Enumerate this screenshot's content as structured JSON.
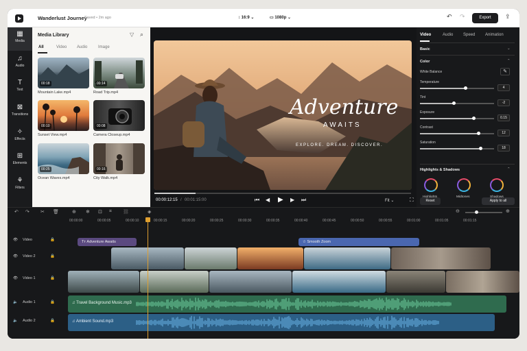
{
  "project": {
    "title": "Wanderlust Journey",
    "saved": "Saved • 2m ago",
    "ratio": "16:9",
    "resolution": "1080p",
    "export_label": "Export"
  },
  "rail": [
    {
      "label": "Media",
      "icon": "media-icon",
      "glyph": "▦"
    },
    {
      "label": "Audio",
      "icon": "music-note-icon",
      "glyph": "♫"
    },
    {
      "label": "Text",
      "icon": "text-icon",
      "glyph": "T"
    },
    {
      "label": "Transitions",
      "icon": "transitions-icon",
      "glyph": "⊠"
    },
    {
      "label": "Effects",
      "icon": "effects-icon",
      "glyph": "✧"
    },
    {
      "label": "Elements",
      "icon": "elements-icon",
      "glyph": "⊞"
    },
    {
      "label": "Filters",
      "icon": "filters-icon",
      "glyph": "⚘"
    }
  ],
  "library": {
    "title": "Media Library",
    "tabs": [
      "All",
      "Video",
      "Audio",
      "Image"
    ],
    "items": [
      {
        "name": "Mountain Lake.mp4",
        "dur": "00:18"
      },
      {
        "name": "Road Trip.mp4",
        "dur": "00:14"
      },
      {
        "name": "Sunset View.mp4",
        "dur": "00:10"
      },
      {
        "name": "Camera Closeup.mp4",
        "dur": "00:08"
      },
      {
        "name": "Ocean Waves.mp4",
        "dur": "00:25"
      },
      {
        "name": "City Walk.mp4",
        "dur": "00:16"
      }
    ]
  },
  "preview": {
    "headline": "Adventure",
    "sub": "AWAITS",
    "tagline": "EXPLORE. DREAM. DISCOVER.",
    "current": "00:00:12:15",
    "total": "00:01:15:00",
    "fit": "Fit"
  },
  "props": {
    "tabs": [
      "Video",
      "Audio",
      "Speed",
      "Animation"
    ],
    "basic": "Basic",
    "color": "Color",
    "white_balance": "White Balance",
    "sliders": [
      {
        "label": "Temperature",
        "value": "4",
        "pos": 0.62
      },
      {
        "label": "Tint",
        "value": "-2",
        "pos": 0.46
      },
      {
        "label": "Exposure",
        "value": "0.15",
        "pos": 0.73
      },
      {
        "label": "Contrast",
        "value": "12",
        "pos": 0.79
      },
      {
        "label": "Saturation",
        "value": "18",
        "pos": 0.82
      }
    ],
    "hs": "Highlights & Shadows",
    "wheels": [
      "Highlights",
      "Midtones",
      "Shadows"
    ],
    "reset": "Reset",
    "apply": "Apply to all"
  },
  "timeline": {
    "ticks": [
      "00:00:00",
      "00:00:05",
      "00:00:10",
      "00:00:15",
      "00:00:20",
      "00:00:25",
      "00:00:30",
      "00:00:35",
      "00:00:40",
      "00:00:45",
      "00:00:50",
      "00:00:55",
      "00:01:00",
      "00:01:05",
      "00:01:15"
    ],
    "tracks": [
      "Video",
      "Video 2",
      "Video 1",
      "Audio 1",
      "Audio 2"
    ],
    "clips": {
      "text1": "Adventure Awaits",
      "text2": "Smooth Zoom",
      "audio1": "Travel Background Music.mp3",
      "audio2": "Ambient Sound.mp3"
    }
  },
  "colors": {
    "accent": "#e0a030",
    "text_clip": "#5b4a80",
    "zoom_clip": "#4a67b0",
    "audio1": "#2f6b4e",
    "audio2": "#2c5f86"
  }
}
